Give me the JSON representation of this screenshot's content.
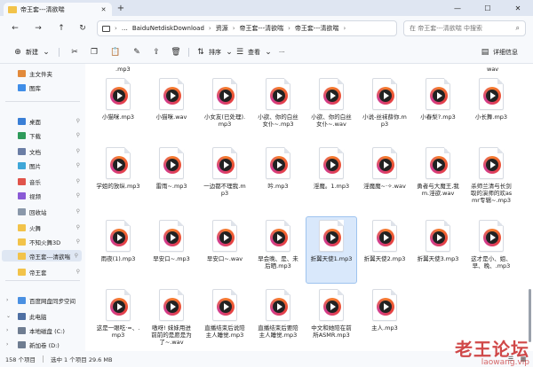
{
  "window": {
    "tab_title": "帝王套---清欲喘",
    "new_tab": "+",
    "minimize": "—",
    "maximize": "☐",
    "close": "✕"
  },
  "nav": {
    "back": "←",
    "forward": "→",
    "up": "↑",
    "refresh": "↻",
    "breadcrumbs": [
      "BaiduNetdiskDownload",
      "资源",
      "帝王套---清欲喘",
      "帝王套---清欲喘"
    ],
    "ellipsis": "…",
    "sep": "›",
    "search_placeholder": "在 帝王套---清欲喘 中搜索"
  },
  "toolbar": {
    "new_label": "新建",
    "sort_label": "排序",
    "view_label": "查看",
    "more_label": "···",
    "details_label": "详细信息"
  },
  "sidebar": {
    "items": [
      {
        "label": "主文件夹",
        "icon": "home-icon",
        "pinned": false
      },
      {
        "label": "图库",
        "icon": "gallery-icon",
        "pinned": false
      },
      {
        "label": "桌面",
        "icon": "desktop-icon",
        "pinned": true
      },
      {
        "label": "下载",
        "icon": "download-icon",
        "pinned": true
      },
      {
        "label": "文档",
        "icon": "document-icon",
        "pinned": true
      },
      {
        "label": "图片",
        "icon": "picture-icon",
        "pinned": true
      },
      {
        "label": "音乐",
        "icon": "music-icon",
        "pinned": true
      },
      {
        "label": "视频",
        "icon": "video-icon",
        "pinned": true
      },
      {
        "label": "回收站",
        "icon": "recycle-bin-icon",
        "pinned": true
      },
      {
        "label": "火舞",
        "icon": "folder-icon",
        "pinned": true
      },
      {
        "label": "不知火舞3D",
        "icon": "folder-icon",
        "pinned": true
      },
      {
        "label": "帝王套---清欲喘",
        "icon": "folder-icon",
        "pinned": true
      },
      {
        "label": "帝王套",
        "icon": "folder-icon",
        "pinned": true
      },
      {
        "label": "百度网盘同步空间",
        "icon": "cloud-icon",
        "pinned": false
      },
      {
        "label": "此电脑",
        "icon": "pc-icon",
        "pinned": false
      },
      {
        "label": "本地磁盘 (C:)",
        "icon": "drive-icon",
        "pinned": false
      },
      {
        "label": "新加卷 (D:)",
        "icon": "drive-icon",
        "pinned": false
      }
    ]
  },
  "files": {
    "top_partial": [
      ".mp3",
      "wav"
    ],
    "rows": [
      [
        "小猫咪.mp3",
        "小猫咪.wav",
        "小女友(已处理).mp3",
        "小欲、你的白丝女仆~.mp3",
        "小欲、你的白丝女仆~.wav",
        "小说-丝袜薛你.mp3",
        "小春梨?.mp3",
        "小长舞.mp3"
      ],
      [
        "学姐的放纵.mp3",
        "雷雨~.mp3",
        "一边都不理我.mp3",
        "吟.mp3",
        "淫魔。1.mp3",
        "淫魔魔~·✧.wav",
        "勇者与大魔王,我m.淫欲.wav",
        "杀师兰清与长剑取的演师的欢asmr专辑~.mp3"
      ],
      [
        "雨夜(1).mp3",
        "早安口~.mp3",
        "早安口~.wav",
        "早会晚、是、未后晒.mp3",
        "折翼天使1.mp3",
        "折翼天使2.mp3",
        "折翼天使3.mp3",
        "这才是小、姐、早、晚、.mp3"
      ],
      [
        "这是一眼吃·=、.mp3",
        "嗷呀! 妹妹用进前前的是愿是为了~.wav",
        "直播结束后说陪主人睡觉.mp3",
        "直播结束后要陪主人睡觉.mp3",
        "中文和她陪在前所ASMR.mp3",
        "主人.mp3"
      ]
    ],
    "selected": "折翼天使1.mp3"
  },
  "status": {
    "count": "158 个项目",
    "selected": "选中 1 个项目 29.6 MB"
  },
  "watermark": {
    "cn": "老王论坛",
    "en": "laowang.vip"
  },
  "colors": {
    "accent": "#0067c0",
    "folder": "#f2c34a",
    "selection": "#d9e8fb"
  }
}
